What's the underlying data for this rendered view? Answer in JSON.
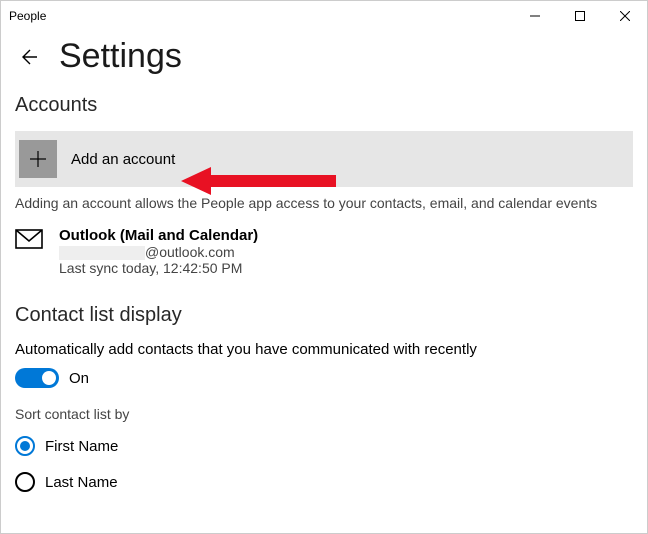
{
  "window": {
    "title": "People"
  },
  "header": {
    "pageTitle": "Settings"
  },
  "accounts": {
    "sectionTitle": "Accounts",
    "addLabel": "Add an account",
    "helpText": "Adding an account allows the People app access to your contacts, email, and calendar events",
    "entry": {
      "name": "Outlook (Mail and Calendar)",
      "emailSuffix": "@outlook.com",
      "lastSync": "Last sync today, 12:42:50 PM"
    }
  },
  "contactList": {
    "sectionTitle": "Contact list display",
    "autoAddDesc": "Automatically add contacts that you have communicated with recently",
    "toggleState": "On",
    "sortHeading": "Sort contact list by",
    "options": {
      "first": "First Name",
      "last": "Last Name"
    }
  }
}
